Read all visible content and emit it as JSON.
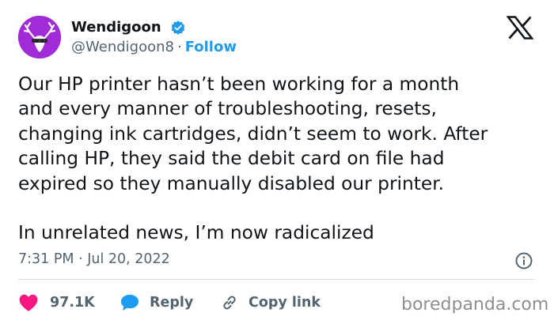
{
  "author": {
    "display_name": "Wendigoon",
    "handle": "@Wendigoon8",
    "separator": "·",
    "follow_label": "Follow",
    "verified": true
  },
  "tweet": {
    "lines_p1": [
      "Our HP printer hasn’t been working for a month",
      "and every manner of troubleshooting, resets,",
      "changing ink cartridges, didn’t seem to work. After",
      "calling HP, they said the debit card on file had",
      "expired so they manually disabled our printer."
    ],
    "lines_p2": [
      "In unrelated news, I’m now radicalized"
    ],
    "timestamp": "7:31 PM · Jul 20, 2022"
  },
  "actions": {
    "likes": "97.1K",
    "reply_label": "Reply",
    "copy_link_label": "Copy link"
  },
  "watermark": "boredpanda.com",
  "icons": {
    "x_logo": "x-logo-icon",
    "verified": "verified-badge-icon",
    "info": "info-icon",
    "like": "heart-icon",
    "reply": "reply-bubble-icon",
    "copy": "link-icon"
  },
  "colors": {
    "text": "#0f1419",
    "secondary": "#536471",
    "accent": "#1d9bf0",
    "like": "#f91880",
    "avatar_bg": "#a12bd6",
    "watermark": "#8e8e8e"
  }
}
